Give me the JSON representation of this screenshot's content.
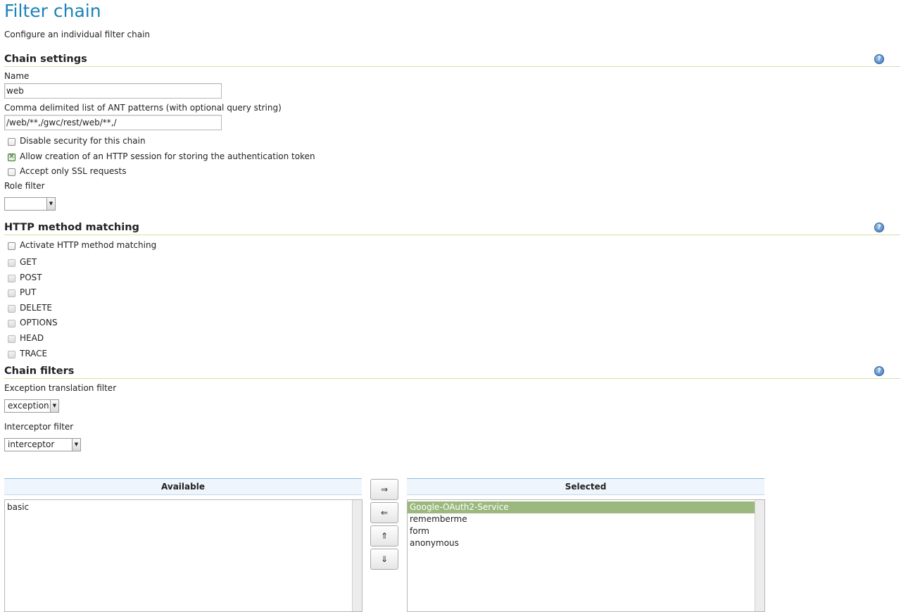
{
  "page": {
    "title": "Filter chain",
    "subtitle": "Configure an individual filter chain"
  },
  "chain_settings": {
    "heading": "Chain settings",
    "help_icon": "help-icon",
    "name_label": "Name",
    "name_value": "web",
    "patterns_label": "Comma delimited list of ANT patterns (with optional query string)",
    "patterns_value": "/web/**,/gwc/rest/web/**,/",
    "disable_security_label": "Disable security for this chain",
    "disable_security_checked": false,
    "allow_session_label": "Allow creation of an HTTP session for storing the authentication token",
    "allow_session_checked": true,
    "ssl_only_label": "Accept only SSL requests",
    "ssl_only_checked": false,
    "role_filter_label": "Role filter",
    "role_filter_value": ""
  },
  "http_method_matching": {
    "heading": "HTTP method matching",
    "activate_label": "Activate HTTP method matching",
    "activate_checked": false,
    "methods": [
      "GET",
      "POST",
      "PUT",
      "DELETE",
      "OPTIONS",
      "HEAD",
      "TRACE"
    ]
  },
  "chain_filters": {
    "heading": "Chain filters",
    "exception_label": "Exception translation filter",
    "exception_value": "exception",
    "interceptor_label": "Interceptor filter",
    "interceptor_value": "interceptor",
    "available_header": "Available",
    "selected_header": "Selected",
    "available": [
      "basic"
    ],
    "selected": [
      "Google-OAuth2-Service",
      "rememberme",
      "form",
      "anonymous"
    ],
    "selected_highlight": "Google-OAuth2-Service",
    "buttons": {
      "add": "⇒",
      "remove": "⇐",
      "up": "⇑",
      "down": "⇓"
    }
  },
  "colors": {
    "title": "#1b83b8",
    "section_rule": "#d6dea6",
    "selected_item": "#9bb97e"
  }
}
